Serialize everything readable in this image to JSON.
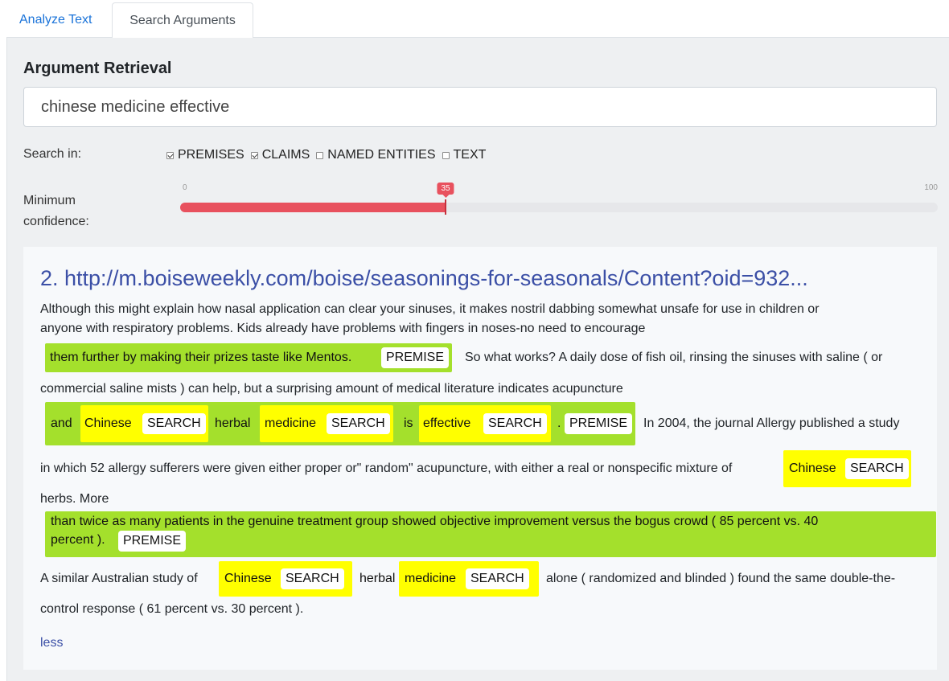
{
  "tabs": {
    "analyze": "Analyze Text",
    "search": "Search Arguments"
  },
  "panel": {
    "heading": "Argument Retrieval",
    "query": "chinese medicine effective"
  },
  "filters": {
    "search_in_label": "Search in:",
    "options": [
      {
        "label": "PREMISES",
        "checked": true
      },
      {
        "label": "CLAIMS",
        "checked": true
      },
      {
        "label": "NAMED ENTITIES",
        "checked": false
      },
      {
        "label": "TEXT",
        "checked": false
      }
    ]
  },
  "confidence": {
    "label_line1": "Minimum",
    "label_line2": "confidence:",
    "min": "0",
    "max": "100",
    "value": "35",
    "fraction": 0.35
  },
  "result": {
    "title": "2. http://m.boiseweekly.com/boise/seasonings-for-seasonals/Content?oid=932...",
    "line1": "Although this might explain how nasal application can clear your sinuses, it makes nostril dabbing somewhat unsafe for use in children or",
    "line2": "anyone with respiratory problems. Kids already have problems with fingers in noses-no need to encourage",
    "premise1_text": "them further by making their prizes taste like Mentos.",
    "after_premise1": "So what works? A daily dose of fish oil, rinsing the sinuses with saline ( or",
    "line4": "commercial saline mists ) can help, but a surprising amount of medical literature indicates acupuncture",
    "p2_and": "and",
    "p2_chinese": "Chinese",
    "p2_herbal": "herbal",
    "p2_medicine": "medicine",
    "p2_is": "is",
    "p2_effective": "effective",
    "p2_dot": ".",
    "after_premise2": "In 2004, the journal Allergy published a study",
    "line6": "in which 52 allergy sufferers were given either proper or\" random\" acupuncture, with either a real or nonspecific mixture of",
    "line6_chinese": "Chinese",
    "line7": "herbs. More",
    "premise3_line1": "than twice as many patients in the genuine treatment group showed objective improvement versus the bogus crowd ( 85 percent vs. 40",
    "premise3_line2": "percent ).",
    "line9_start": "A similar Australian study of",
    "line9_chinese": "Chinese",
    "line9_herbal": "herbal",
    "line9_medicine": "medicine",
    "line9_end": "alone ( randomized and blinded ) found the same double-the-",
    "line10": "control response ( 61 percent vs. 30 percent ).",
    "less": "less",
    "premise_tag": "PREMISE",
    "search_tag": "SEARCH"
  },
  "colors": {
    "premise": "#a4e02c",
    "search": "#ffff00",
    "slider": "#e8515e",
    "link": "#3b4fa6"
  }
}
